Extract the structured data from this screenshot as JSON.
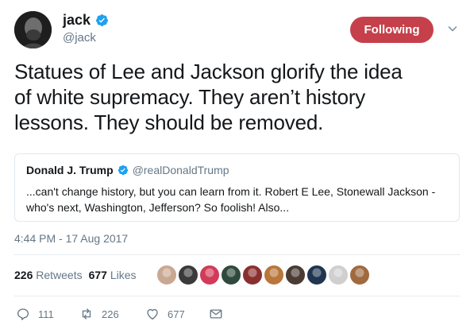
{
  "author": {
    "name": "jack",
    "handle": "@jack",
    "verified_color": "#1da1f2"
  },
  "follow_button": {
    "label": "Following",
    "color": "#c5404a"
  },
  "tweet": {
    "text_line1": "Statues of Lee and Jackson glorify the idea",
    "text_line2": "of white supremacy. They aren’t history",
    "text_line3": "lessons. They should be removed."
  },
  "quoted": {
    "name": "Donald J. Trump",
    "handle": "@realDonaldTrump",
    "text_line1": "...can't change history, but you can learn from it. Robert E Lee, Stonewall Jackson -",
    "text_line2": "who's next, Washington, Jefferson? So foolish! Also..."
  },
  "timestamp": "4:44 PM - 17 Aug 2017",
  "stats": {
    "retweets_count": "226",
    "retweets_label": "Retweets",
    "likes_count": "677",
    "likes_label": "Likes"
  },
  "likers": [
    {
      "color": "#c9a892",
      "icon": "avatar"
    },
    {
      "color": "#3a3a3a",
      "icon": "avatar"
    },
    {
      "color": "#d23a5a",
      "icon": "avatar"
    },
    {
      "color": "#2f4a3c",
      "icon": "avatar"
    },
    {
      "color": "#8a2f2f",
      "icon": "avatar"
    },
    {
      "color": "#b8763a",
      "icon": "avatar"
    },
    {
      "color": "#4a3b33",
      "icon": "avatar"
    },
    {
      "color": "#1f3550",
      "icon": "avatar"
    },
    {
      "color": "#cfcfcf",
      "icon": "avatar"
    },
    {
      "color": "#a06a40",
      "icon": "avatar"
    }
  ],
  "actions": {
    "reply_count": "111",
    "retweet_count": "226",
    "like_count": "677"
  }
}
